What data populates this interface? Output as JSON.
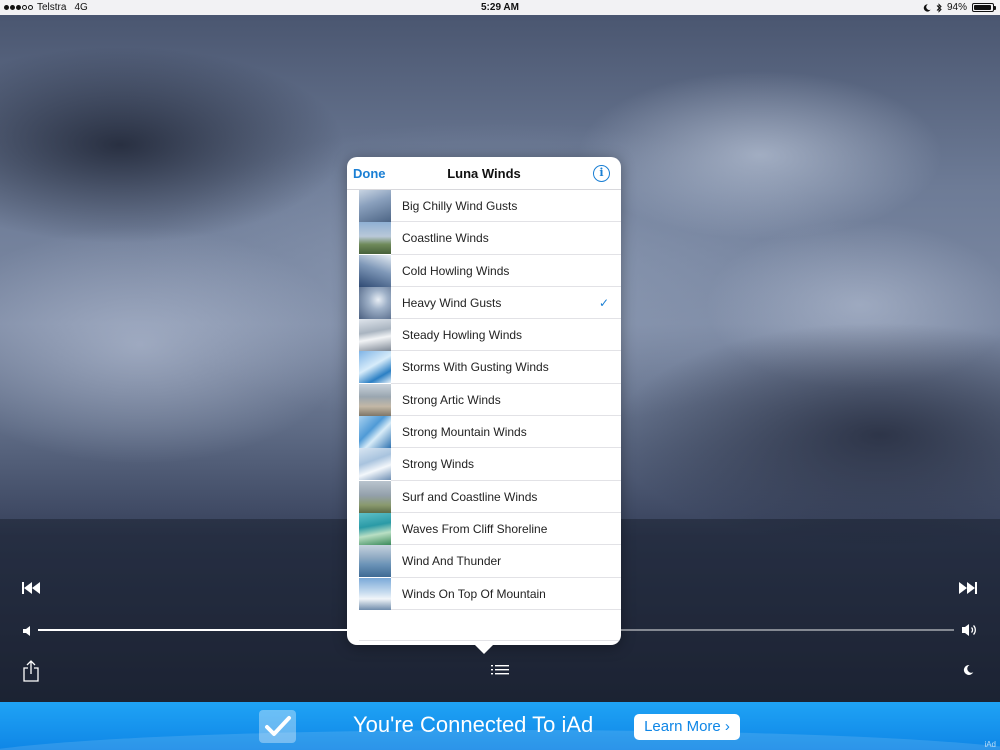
{
  "status_bar": {
    "carrier": "Telstra",
    "network": "4G",
    "time": "5:29 AM",
    "battery": "94%",
    "battery_level": 0.94
  },
  "popover": {
    "done_label": "Done",
    "title": "Luna Winds",
    "info_label": "i",
    "check_glyph": "✓",
    "selected_index": 3,
    "items": [
      {
        "label": "Big Chilly Wind Gusts",
        "thumb": "t0"
      },
      {
        "label": "Coastline Winds",
        "thumb": "t1"
      },
      {
        "label": "Cold Howling Winds",
        "thumb": "t2"
      },
      {
        "label": "Heavy Wind Gusts",
        "thumb": "t3"
      },
      {
        "label": "Steady Howling Winds",
        "thumb": "t4"
      },
      {
        "label": "Storms With Gusting Winds",
        "thumb": "t5"
      },
      {
        "label": "Strong Artic Winds",
        "thumb": "t6"
      },
      {
        "label": "Strong Mountain Winds",
        "thumb": "t7"
      },
      {
        "label": "Strong Winds",
        "thumb": "t8"
      },
      {
        "label": "Surf and Coastline Winds",
        "thumb": "t9"
      },
      {
        "label": "Waves From Cliff Shoreline",
        "thumb": "t10"
      },
      {
        "label": "Wind And Thunder",
        "thumb": "t11"
      },
      {
        "label": "Winds On Top Of Mountain",
        "thumb": "t12"
      }
    ]
  },
  "player": {
    "volume_level": 0.34,
    "icons": [
      "skip-back-icon",
      "skip-forward-icon",
      "volume-low-icon",
      "volume-high-icon",
      "share-icon",
      "list-icon",
      "moon-icon"
    ]
  },
  "ad": {
    "text": "You're Connected To iAd",
    "button_label": "Learn More ›",
    "mark": "iAd"
  }
}
